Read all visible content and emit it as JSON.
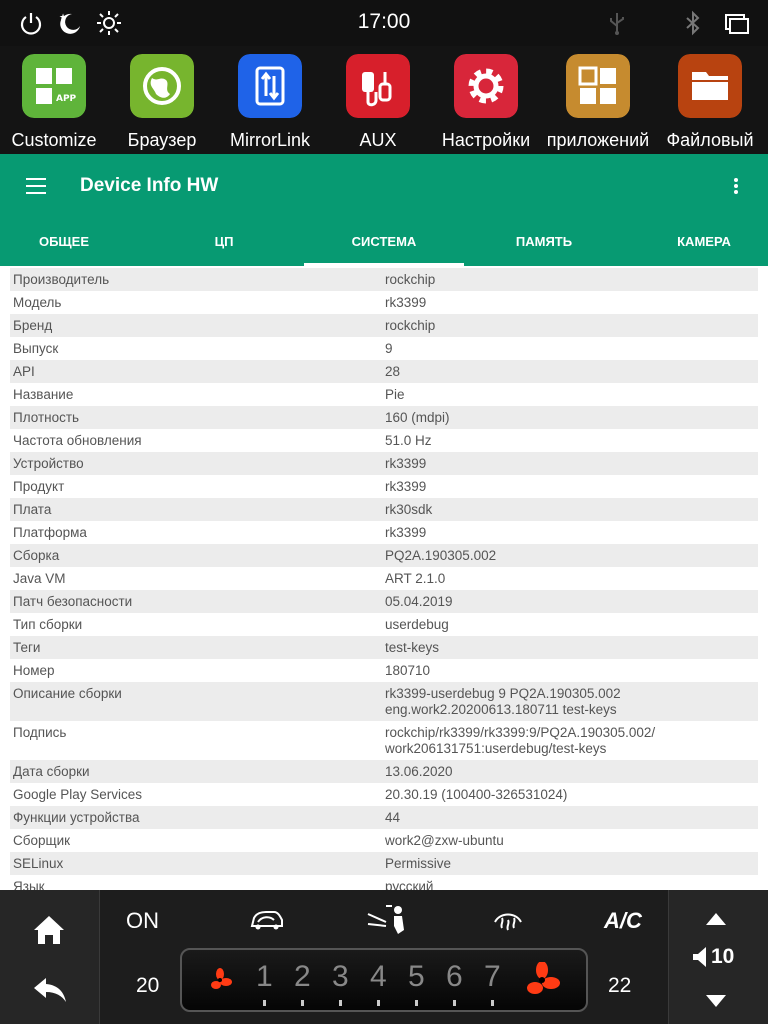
{
  "statusbar": {
    "time": "17:00"
  },
  "launcher": {
    "apps": [
      {
        "label": "Customize",
        "badge": "APP",
        "color": "#5fb43a"
      },
      {
        "label": "Браузер",
        "color": "#77b52e"
      },
      {
        "label": "MirrorLink",
        "color": "#1f63e8"
      },
      {
        "label": "AUX",
        "color": "#d71f2b"
      },
      {
        "label": "Настройки",
        "color": "#d8263a"
      },
      {
        "label": "приложений",
        "color": "#c68b2f"
      },
      {
        "label": "Файловый",
        "color": "#b84310"
      }
    ]
  },
  "appbar": {
    "title": "Device Info HW"
  },
  "tabs": [
    {
      "label": "ОБЩЕЕ",
      "active": false
    },
    {
      "label": "ЦП",
      "active": false
    },
    {
      "label": "СИСТЕМА",
      "active": true
    },
    {
      "label": "ПАМЯТЬ",
      "active": false
    },
    {
      "label": "КАМЕРА",
      "active": false
    }
  ],
  "system_info": [
    {
      "key": "Производитель",
      "value": "rockchip"
    },
    {
      "key": "Модель",
      "value": "rk3399"
    },
    {
      "key": "Бренд",
      "value": "rockchip"
    },
    {
      "key": "Выпуск",
      "value": "9"
    },
    {
      "key": "API",
      "value": "28"
    },
    {
      "key": "Название",
      "value": "Pie"
    },
    {
      "key": "Плотность",
      "value": "160 (mdpi)"
    },
    {
      "key": "Частота обновления",
      "value": "51.0 Hz"
    },
    {
      "key": "Устройство",
      "value": "rk3399"
    },
    {
      "key": "Продукт",
      "value": "rk3399"
    },
    {
      "key": "Плата",
      "value": "rk30sdk"
    },
    {
      "key": "Платформа",
      "value": "rk3399"
    },
    {
      "key": "Сборка",
      "value": "PQ2A.190305.002"
    },
    {
      "key": "Java VM",
      "value": "ART 2.1.0"
    },
    {
      "key": "Патч безопасности",
      "value": "05.04.2019"
    },
    {
      "key": "Тип сборки",
      "value": "userdebug"
    },
    {
      "key": "Теги",
      "value": "test-keys"
    },
    {
      "key": "Номер",
      "value": "180710"
    },
    {
      "key": "Описание сборки",
      "value": "rk3399-userdebug 9 PQ2A.190305.002",
      "value2": "eng.work2.20200613.180711 test-keys"
    },
    {
      "key": "Подпись",
      "value": "rockchip/rk3399/rk3399:9/PQ2A.190305.002/",
      "value2": "work206131751:userdebug/test-keys"
    },
    {
      "key": "Дата сборки",
      "value": "13.06.2020"
    },
    {
      "key": "Google Play Services",
      "value": "20.30.19 (100400-326531024)"
    },
    {
      "key": "Функции устройства",
      "value": "44"
    },
    {
      "key": "Сборщик",
      "value": "work2@zxw-ubuntu"
    },
    {
      "key": "SELinux",
      "value": "Permissive"
    },
    {
      "key": "Язык",
      "value": "русский"
    }
  ],
  "climate": {
    "on_label": "ON",
    "ac_label": "A/C",
    "temp_left": "20",
    "temp_right": "22",
    "fan_levels": [
      "1",
      "2",
      "3",
      "4",
      "5",
      "6",
      "7"
    ],
    "volume": "10"
  }
}
